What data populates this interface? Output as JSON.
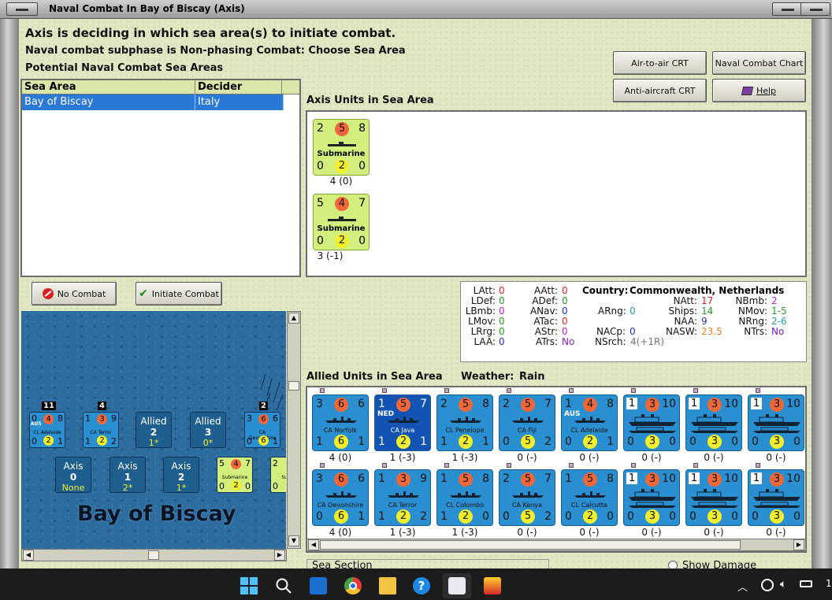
{
  "window": {
    "title": "Naval Combat In Bay of Biscay (Axis)"
  },
  "headers": {
    "status": "Axis is deciding in which sea area(s) to initiate combat.",
    "subphase": "Naval combat subphase is Non-phasing Combat: Choose Sea Area",
    "potential": "Potential Naval Combat Sea Areas",
    "axis_units": "Axis Units in Sea Area",
    "allied_units": "Allied Units in Sea Area",
    "weather_label": "Weather:",
    "weather_value": "Rain",
    "sea_section": "Sea Section",
    "show_damage": "Show Damage"
  },
  "sea_table": {
    "columns": [
      "Sea Area",
      "Decider"
    ],
    "rows": [
      [
        "Bay of Biscay",
        "Italy"
      ]
    ]
  },
  "buttons": {
    "air_to_air": "Air-to-air CRT",
    "naval_chart": "Naval Combat Chart",
    "anti_aircraft": "Anti-aircraft CRT",
    "help": "Help",
    "no_combat": "No Combat",
    "initiate_combat": "Initiate Combat"
  },
  "axis_units": [
    {
      "tl": "2",
      "tc": "5",
      "tr": "8",
      "name": "Submarine",
      "bl": "0",
      "bc": "2",
      "br": "0",
      "below": "4 (0)"
    },
    {
      "tl": "5",
      "tc": "4",
      "tr": "7",
      "name": "Submarine",
      "bl": "0",
      "bc": "2",
      "br": "0",
      "below": "3 (-1)"
    }
  ],
  "allied_row1": [
    {
      "tl": "3",
      "tc": "6",
      "tr": "6",
      "name": "CA Norfolk",
      "nat": "",
      "bl": "1",
      "bc": "6",
      "br": "1",
      "below": "4 (0)",
      "box": false,
      "sel": false
    },
    {
      "tl": "1",
      "tc": "5",
      "tr": "7",
      "name": "CA Java",
      "nat": "NED",
      "bl": "1",
      "bc": "2",
      "br": "1",
      "below": "1 (-3)",
      "box": false,
      "sel": true
    },
    {
      "tl": "2",
      "tc": "5",
      "tr": "8",
      "name": "CL Penelope",
      "nat": "",
      "bl": "1",
      "bc": "2",
      "br": "1",
      "below": "1 (-3)",
      "box": false,
      "sel": false
    },
    {
      "tl": "2",
      "tc": "5",
      "tr": "7",
      "name": "CA Fiji",
      "nat": "",
      "bl": "0",
      "bc": "5",
      "br": "2",
      "below": "0 (-)",
      "box": false,
      "sel": false
    },
    {
      "tl": "1",
      "tc": "4",
      "tr": "8",
      "name": "CL Adelaide",
      "nat": "AUS",
      "bl": "0",
      "bc": "2",
      "br": "1",
      "below": "0 (-)",
      "box": false,
      "sel": false
    },
    {
      "tl": "1",
      "tc": "3",
      "tr": "10",
      "name": "",
      "nat": "",
      "bl": "0",
      "bc": "3",
      "br": "0",
      "below": "0 (-)",
      "box": true,
      "sel": false
    },
    {
      "tl": "1",
      "tc": "3",
      "tr": "10",
      "name": "",
      "nat": "",
      "bl": "0",
      "bc": "3",
      "br": "0",
      "below": "0 (-)",
      "box": true,
      "sel": false
    },
    {
      "tl": "1",
      "tc": "3",
      "tr": "10",
      "name": "",
      "nat": "",
      "bl": "0",
      "bc": "3",
      "br": "0",
      "below": "0 (-)",
      "box": true,
      "sel": false
    }
  ],
  "allied_row2": [
    {
      "tl": "3",
      "tc": "6",
      "tr": "6",
      "name": "CA Devonshire",
      "nat": "",
      "bl": "0",
      "bc": "6",
      "br": "1",
      "below": "4 (0)",
      "box": false,
      "sel": false
    },
    {
      "tl": "1",
      "tc": "3",
      "tr": "9",
      "name": "CA Terror",
      "nat": "",
      "bl": "1",
      "bc": "2",
      "br": "2",
      "below": "1 (-3)",
      "box": false,
      "sel": false
    },
    {
      "tl": "1",
      "tc": "5",
      "tr": "8",
      "name": "CL Colombo",
      "nat": "",
      "bl": "1",
      "bc": "2",
      "br": "0",
      "below": "1 (-3)",
      "box": false,
      "sel": false
    },
    {
      "tl": "2",
      "tc": "5",
      "tr": "7",
      "name": "CA Kenya",
      "nat": "",
      "bl": "0",
      "bc": "5",
      "br": "2",
      "below": "0 (-)",
      "box": false,
      "sel": false
    },
    {
      "tl": "1",
      "tc": "5",
      "tr": "8",
      "name": "CL Calcutta",
      "nat": "",
      "bl": "0",
      "bc": "2",
      "br": "0",
      "below": "0 (-)",
      "box": false,
      "sel": false
    },
    {
      "tl": "1",
      "tc": "3",
      "tr": "10",
      "name": "",
      "nat": "",
      "bl": "0",
      "bc": "3",
      "br": "0",
      "below": "0 (-)",
      "box": true,
      "sel": false
    },
    {
      "tl": "1",
      "tc": "3",
      "tr": "10",
      "name": "",
      "nat": "",
      "bl": "0",
      "bc": "3",
      "br": "0",
      "below": "0 (-)",
      "box": true,
      "sel": false
    },
    {
      "tl": "1",
      "tc": "3",
      "tr": "10",
      "name": "",
      "nat": "",
      "bl": "0",
      "bc": "3",
      "br": "0",
      "below": "0 (-)",
      "box": true,
      "sel": false
    }
  ],
  "stats": {
    "country_label": "Country:",
    "country_value": "Commonwealth, Netherlands",
    "col1": [
      {
        "k": "LAtt:",
        "v": "0",
        "c": "#e02020"
      },
      {
        "k": "LDef:",
        "v": "0",
        "c": "#20a020"
      },
      {
        "k": "LBmb:",
        "v": "0",
        "c": "#c020c0"
      },
      {
        "k": "LMov:",
        "v": "0",
        "c": "#20a020"
      },
      {
        "k": "LRrg:",
        "v": "0",
        "c": "#20a020"
      },
      {
        "k": "LAA:",
        "v": "0",
        "c": "#2030c0"
      }
    ],
    "col2": [
      {
        "k": "AAtt:",
        "v": "0",
        "c": "#e02020"
      },
      {
        "k": "ADef:",
        "v": "0",
        "c": "#20a020"
      },
      {
        "k": "ANav:",
        "v": "0",
        "c": "#2030c0"
      },
      {
        "k": "ATac:",
        "v": "0",
        "c": "#e02020"
      },
      {
        "k": "AStr:",
        "v": "0",
        "c": "#c020c0"
      },
      {
        "k": "ATrs:",
        "v": "No",
        "c": "#8020c0"
      }
    ],
    "arng": {
      "k": "ARng:",
      "v": "0",
      "c": "#20a0a0"
    },
    "nacp": {
      "k": "NACp:",
      "v": "0",
      "c": "#2030c0"
    },
    "nsrch": {
      "k": "NSrch:",
      "v": "4(+1R)",
      "c": "#777777"
    },
    "col3": [
      {
        "k": "NAtt:",
        "v": "17",
        "c": "#e02020"
      },
      {
        "k": "Ships:",
        "v": "14",
        "c": "#20a020"
      },
      {
        "k": "NAA:",
        "v": "9",
        "c": "#2030c0"
      },
      {
        "k": "NASW:",
        "v": "23.5",
        "c": "#e08020"
      }
    ],
    "col4": [
      {
        "k": "NBmb:",
        "v": "2",
        "c": "#c020c0"
      },
      {
        "k": "NMov:",
        "v": "1-5",
        "c": "#20a020"
      },
      {
        "k": "NRng:",
        "v": "2-6",
        "c": "#20a0a0"
      },
      {
        "k": "NTrs:",
        "v": "No",
        "c": "#8020c0"
      }
    ]
  },
  "map": {
    "name": "Bay of Biscay",
    "stack_a": "11",
    "stack_b": "4",
    "stack_c": "2",
    "ctr1": {
      "tl": "0",
      "tc": "4",
      "tr": "8",
      "name": "CL Adelaide",
      "nat": "AUS",
      "bl": "0",
      "bc": "2",
      "br": "1"
    },
    "ctr2": {
      "tl": "1",
      "tc": "3",
      "tr": "9",
      "name": "CA Terror",
      "bl": "1",
      "bc": "2",
      "br": "2"
    },
    "ctr3": {
      "tl": "3",
      "tc": "6",
      "tr": "6",
      "name": "CA Devonshire",
      "bl": "0",
      "bc": "6",
      "br": "1"
    },
    "ctr4": {
      "tl": "5",
      "tc": "4",
      "tr": "7",
      "name": "Submarine",
      "bl": "0",
      "bc": "2",
      "br": "0"
    },
    "ctr5": {
      "tl": "2",
      "bl": "0",
      "name": "Subm"
    },
    "boxes": [
      {
        "t": "Allied",
        "n": "2",
        "v": "1*"
      },
      {
        "t": "Allied",
        "n": "3",
        "v": "0*"
      },
      {
        "t": "Axis",
        "n": "0",
        "v": "None"
      },
      {
        "t": "Axis",
        "n": "1",
        "v": "2*"
      },
      {
        "t": "Axis",
        "n": "2",
        "v": "1*"
      }
    ]
  },
  "taskbar": {
    "clock": "1"
  }
}
